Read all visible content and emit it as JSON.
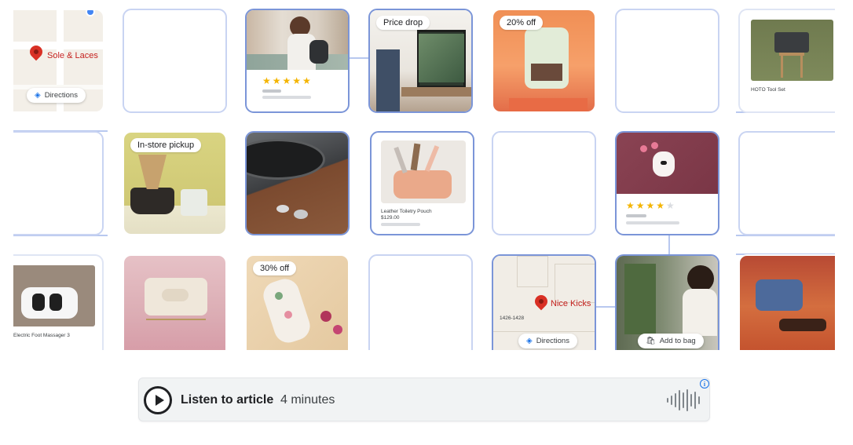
{
  "tiles": {
    "sole_laces": {
      "place_name": "Sole & Laces",
      "directions_label": "Directions"
    },
    "portrait": {
      "rating": 5
    },
    "kitchen": {
      "badge": "Price drop"
    },
    "espresso": {
      "badge": "20% off"
    },
    "toolset": {
      "caption": "HOTO Tool Set"
    },
    "coffee": {
      "badge": "In-store pickup"
    },
    "pouch": {
      "title": "Leather Toiletry Pouch",
      "price": "$129.00"
    },
    "earbuds": {
      "rating": 4
    },
    "massager": {
      "caption": "Electric Foot Massager 3"
    },
    "gloves": {
      "badge": "30% off"
    },
    "nice_kicks": {
      "place_name": "Nice Kicks",
      "address": "1426-1428",
      "directions_label": "Directions"
    },
    "makeup": {
      "add_to_bag_label": "Add to bag"
    }
  },
  "listen": {
    "label": "Listen to article",
    "duration": "4 minutes",
    "info_glyph": "i"
  },
  "icons": {
    "play": "play-icon",
    "directions": "directions-icon",
    "bag": "shopping-bag-icon",
    "waveform": "audio-waveform-icon",
    "info": "info-icon",
    "pin": "map-pin-icon"
  }
}
